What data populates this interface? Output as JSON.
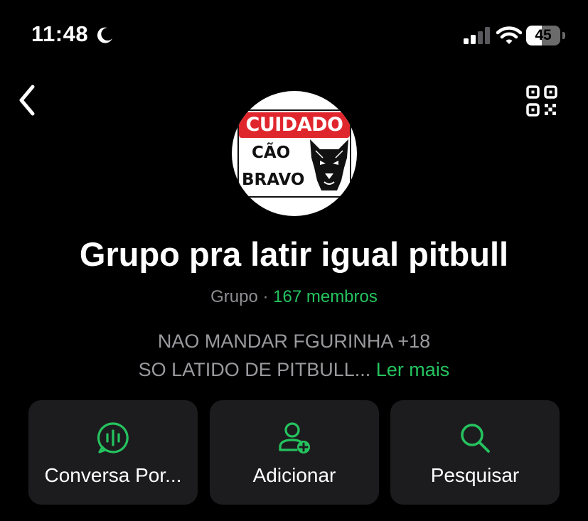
{
  "status_bar": {
    "time": "11:48",
    "battery_level": "45",
    "battery_fraction": 0.45
  },
  "icons": {
    "moon": "moon-icon",
    "signal": "cellular-signal-icon",
    "wifi": "wifi-icon",
    "back": "chevron-left-icon",
    "qr": "qr-code-icon",
    "voice_chat": "voice-chat-icon",
    "add_user": "add-user-icon",
    "search": "search-icon"
  },
  "colors": {
    "background": "#000000",
    "accent_green": "#25c35f",
    "card_background": "#1c1c1e",
    "secondary_text": "#8e8e93",
    "sign_red": "#e0262d"
  },
  "avatar": {
    "sign_header": "CUIDADO",
    "sign_line_1": "CÃO",
    "sign_line_2": "BRAVO"
  },
  "group": {
    "title": "Grupo pra latir igual pitbull",
    "type_label": "Grupo",
    "separator": " · ",
    "members": "167 membros",
    "description_line_1": "NAO MANDAR FGURINHA +18",
    "description_line_2": "SO LATIDO DE PITBULL...",
    "read_more": "Ler mais"
  },
  "actions": [
    {
      "label": "Conversa Por..."
    },
    {
      "label": "Adicionar"
    },
    {
      "label": "Pesquisar"
    }
  ]
}
